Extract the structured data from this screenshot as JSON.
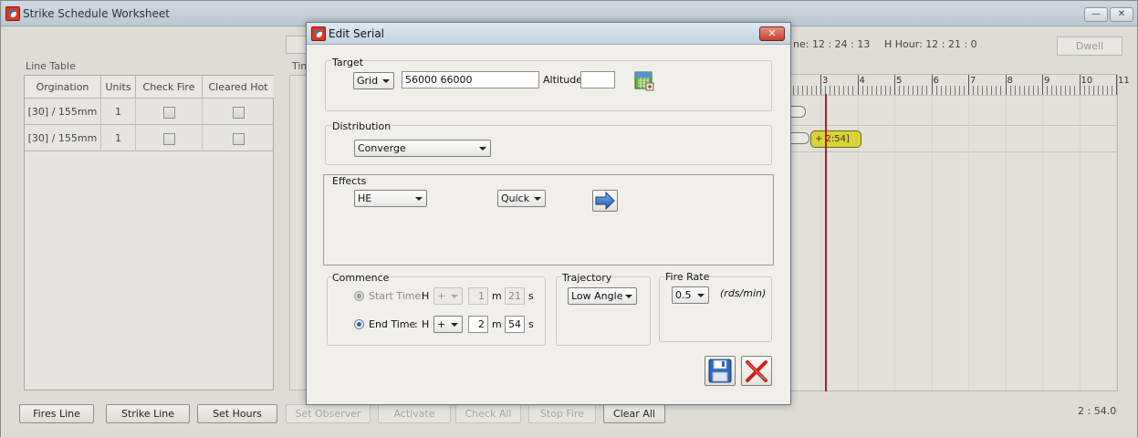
{
  "main_window": {
    "title": "Strike Schedule Worksheet",
    "minimize_label": "—",
    "close_label": "✕",
    "line_table_label": "Line Table",
    "timeline_label": "Tim",
    "line_table": {
      "headers": [
        "Orgination",
        "Units",
        "Check Fire",
        "Cleared Hot"
      ],
      "rows": [
        {
          "origination": "[30] / 155mm",
          "units": "1"
        },
        {
          "origination": "[30] / 155mm",
          "units": "1"
        }
      ]
    },
    "time_info": "ne:  12 : 24 : 13",
    "h_hour_info": "H Hour:  12 : 21 : 0",
    "dwell_label": "Dwell",
    "ruler_labels": [
      "3",
      "4",
      "5",
      "6",
      "7",
      "8",
      "9",
      "10",
      "11"
    ],
    "bar_label": "+ 2:54]",
    "elapsed_time": "2 : 54.0",
    "bottom_buttons": {
      "fires_line": "Fires Line",
      "strike_line": "Strike Line",
      "set_hours": "Set Hours",
      "set_observer": "Set Observer",
      "activate": "Activate",
      "check_all": "Check All",
      "stop_fire": "Stop Fire",
      "clear_all": "Clear All"
    }
  },
  "dialog": {
    "title": "Edit Serial",
    "close_label": "✕",
    "target": {
      "label": "Target",
      "grid_type": "Grid",
      "grid_value": "56000 66000",
      "altitude_label": "Altitude",
      "altitude_value": ""
    },
    "distribution": {
      "label": "Distribution",
      "value": "Converge"
    },
    "effects": {
      "label": "Effects",
      "munition": "HE",
      "fuze": "Quick"
    },
    "commence": {
      "label": "Commence",
      "start_time": {
        "label": "Start Time:",
        "h_label": "H",
        "sign": "+",
        "minutes": "1",
        "m_label": "m",
        "seconds": "21",
        "s_label": "s"
      },
      "end_time": {
        "label": "End Time",
        "colon": ":",
        "h_label": "H",
        "sign": "+",
        "minutes": "2",
        "m_label": "m",
        "seconds": "54",
        "s_label": "s"
      }
    },
    "trajectory": {
      "label": "Trajectory",
      "value": "Low Angle"
    },
    "fire_rate": {
      "label": "Fire Rate",
      "value": "0.5",
      "unit": "(rds/min)"
    }
  },
  "colors": {
    "timeline_marker": "#c01818",
    "bar_fill": "#d8d437",
    "radio_selected": "#2b64b6"
  }
}
